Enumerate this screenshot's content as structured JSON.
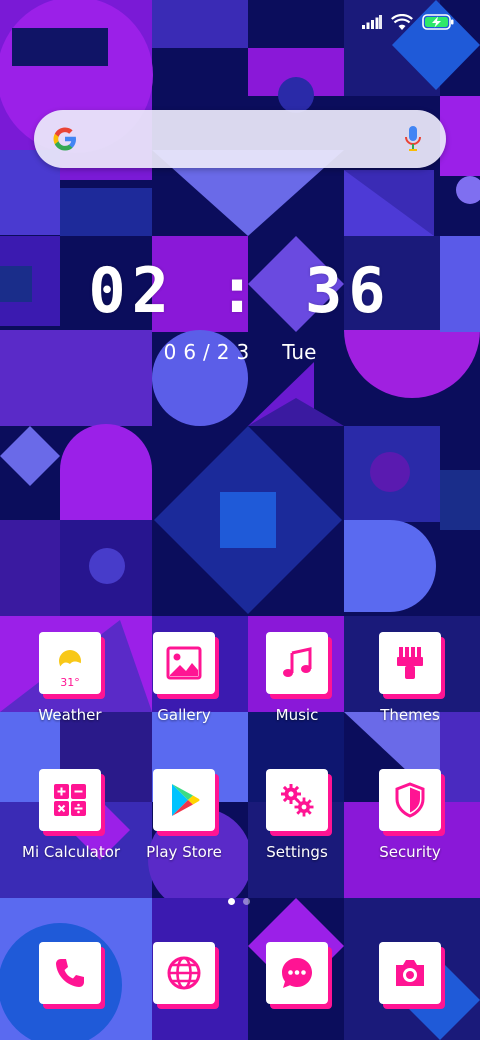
{
  "status_bar": {
    "icons": [
      "signal-icon",
      "wifi-icon",
      "battery-charging-icon"
    ]
  },
  "search": {
    "logo_icon": "google-g-icon",
    "mic_icon": "microphone-icon"
  },
  "clock": {
    "time": "02 : 36",
    "date": "06/23",
    "day": "Tue"
  },
  "apps": [
    {
      "label": "Weather",
      "icon": "weather-icon",
      "temp": "31°"
    },
    {
      "label": "Gallery",
      "icon": "gallery-icon"
    },
    {
      "label": "Music",
      "icon": "music-icon"
    },
    {
      "label": "Themes",
      "icon": "themes-icon"
    },
    {
      "label": "Mi Calculator",
      "icon": "calculator-icon"
    },
    {
      "label": "Play Store",
      "icon": "play-store-icon"
    },
    {
      "label": "Settings",
      "icon": "settings-icon"
    },
    {
      "label": "Security",
      "icon": "security-icon"
    }
  ],
  "dock": [
    {
      "icon": "phone-icon"
    },
    {
      "icon": "browser-icon"
    },
    {
      "icon": "messaging-icon"
    },
    {
      "icon": "camera-icon"
    }
  ],
  "page_indicator": {
    "pages": 2,
    "active": 1
  },
  "colors": {
    "accent": "#ff1493",
    "tile": "#ffffff",
    "background": "#0b0d5c"
  }
}
